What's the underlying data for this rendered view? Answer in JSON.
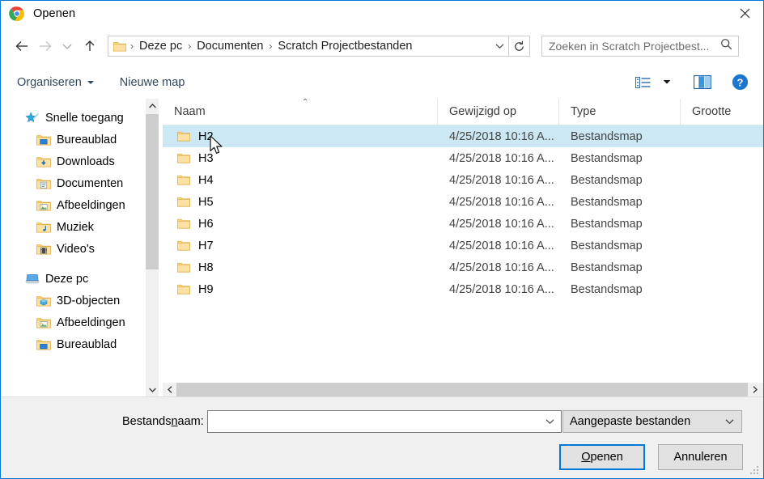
{
  "window": {
    "title": "Openen",
    "app_icon": "chrome-logo-icon",
    "close_label": "✕",
    "accent_color": "#0078d7"
  },
  "nav": {
    "back_icon": "arrow-left-icon",
    "forward_icon": "arrow-right-icon",
    "recent_icon": "chevron-down-icon",
    "up_icon": "arrow-up-icon",
    "refresh_icon": "refresh-icon"
  },
  "breadcrumb": {
    "folder_icon": "folder-icon",
    "separator": "›",
    "items": [
      {
        "label": "Deze pc"
      },
      {
        "label": "Documenten"
      },
      {
        "label": "Scratch Projectbestanden"
      }
    ],
    "dropdown_icon": "chevron-down-icon"
  },
  "search": {
    "placeholder": "Zoeken in Scratch Projectbest...",
    "value": "",
    "icon": "search-icon"
  },
  "toolbar": {
    "organiseren_label": "Organiseren",
    "nieuwe_map_label": "Nieuwe map",
    "view_icon": "view-options-icon",
    "view_caret_icon": "chevron-down-icon",
    "preview_icon": "preview-pane-icon",
    "help_icon": "help-icon"
  },
  "sidebar": {
    "groups": [
      {
        "name": "quick-access",
        "header": {
          "label": "Snelle toegang",
          "icon": "star-pin-icon"
        },
        "items": [
          {
            "label": "Bureaublad",
            "icon": "folder-desktop-icon",
            "pinned": true
          },
          {
            "label": "Downloads",
            "icon": "folder-downloads-icon",
            "pinned": true
          },
          {
            "label": "Documenten",
            "icon": "folder-documents-icon",
            "pinned": true
          },
          {
            "label": "Afbeeldingen",
            "icon": "folder-pictures-icon",
            "pinned": true
          },
          {
            "label": "Muziek",
            "icon": "folder-music-icon",
            "pinned": false
          },
          {
            "label": "Video's",
            "icon": "folder-videos-icon",
            "pinned": false
          }
        ]
      },
      {
        "name": "this-pc",
        "header": {
          "label": "Deze pc",
          "icon": "computer-icon"
        },
        "items": [
          {
            "label": "3D-objecten",
            "icon": "folder-3d-icon",
            "pinned": false
          },
          {
            "label": "Afbeeldingen",
            "icon": "folder-pictures-icon",
            "pinned": false
          },
          {
            "label": "Bureaublad",
            "icon": "folder-desktop-icon",
            "pinned": false
          }
        ]
      }
    ],
    "pin_icon": "pin-icon",
    "scrollbar": {
      "up_icon": "chevron-up-icon",
      "down_icon": "chevron-down-icon"
    }
  },
  "filelist": {
    "columns": [
      {
        "key": "naam",
        "label": "Naam"
      },
      {
        "key": "gewijzigd",
        "label": "Gewijzigd op"
      },
      {
        "key": "type",
        "label": "Type"
      },
      {
        "key": "grootte",
        "label": "Grootte"
      }
    ],
    "sort_indicator": "⌃",
    "rows": [
      {
        "naam": "H2",
        "gewijzigd": "4/25/2018 10:16 A...",
        "type": "Bestandsmap",
        "grootte": "",
        "selected": true
      },
      {
        "naam": "H3",
        "gewijzigd": "4/25/2018 10:16 A...",
        "type": "Bestandsmap",
        "grootte": "",
        "selected": false
      },
      {
        "naam": "H4",
        "gewijzigd": "4/25/2018 10:16 A...",
        "type": "Bestandsmap",
        "grootte": "",
        "selected": false
      },
      {
        "naam": "H5",
        "gewijzigd": "4/25/2018 10:16 A...",
        "type": "Bestandsmap",
        "grootte": "",
        "selected": false
      },
      {
        "naam": "H6",
        "gewijzigd": "4/25/2018 10:16 A...",
        "type": "Bestandsmap",
        "grootte": "",
        "selected": false
      },
      {
        "naam": "H7",
        "gewijzigd": "4/25/2018 10:16 A...",
        "type": "Bestandsmap",
        "grootte": "",
        "selected": false
      },
      {
        "naam": "H8",
        "gewijzigd": "4/25/2018 10:16 A...",
        "type": "Bestandsmap",
        "grootte": "",
        "selected": false
      },
      {
        "naam": "H9",
        "gewijzigd": "4/25/2018 10:16 A...",
        "type": "Bestandsmap",
        "grootte": "",
        "selected": false
      }
    ],
    "row_icon": "folder-icon",
    "hscrollbar": {
      "left_icon": "chevron-left-icon",
      "right_icon": "chevron-right-icon"
    }
  },
  "bottom": {
    "filename_label_pre": "Bestands",
    "filename_label_accel": "n",
    "filename_label_post": "aam:",
    "filename_value": "",
    "filename_placeholder": "",
    "filename_caret_icon": "chevron-down-icon",
    "filter_value": "Aangepaste bestanden",
    "filter_caret_icon": "chevron-down-icon",
    "open_label_accel": "O",
    "open_label_rest": "penen",
    "cancel_label": "Annuleren",
    "resize_grip_icon": "resize-grip-icon"
  }
}
